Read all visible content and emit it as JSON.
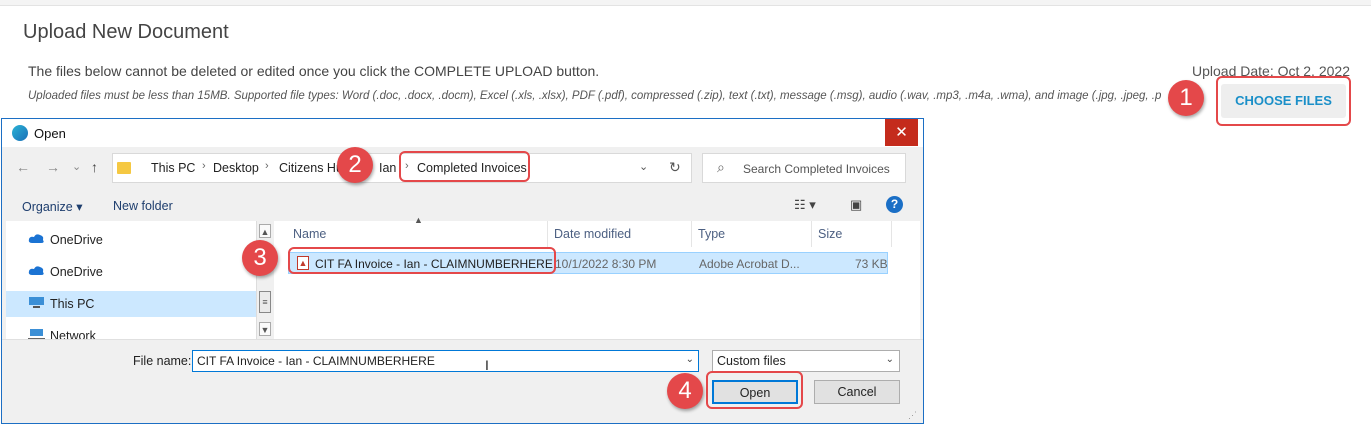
{
  "page": {
    "title": "Upload New Document",
    "note": "The files below cannot be deleted or edited once you click the COMPLETE UPLOAD button.",
    "file_types_note": "Uploaded files must be less than 15MB. Supported file types: Word (.doc, .docx, .docm), Excel (.xls, .xlsx), PDF (.pdf), compressed (.zip), text (.txt), message (.msg), audio (.wav, .mp3, .m4a, .wma), and image (.jpg, .jpeg, .p",
    "upload_date": "Upload Date: Oct 2, 2022",
    "choose_files_label": "CHOOSE FILES"
  },
  "steps": [
    "1",
    "2",
    "3",
    "4"
  ],
  "colors": {
    "annotation": "#e4484a",
    "accent": "#1a8fc8",
    "selection": "#cce8ff"
  },
  "dialog": {
    "title": "Open",
    "close_glyph": "✕",
    "nav": {
      "back": "←",
      "forward": "→",
      "recent": "⌄",
      "up": "↑"
    },
    "breadcrumb": [
      "This PC",
      "Desktop",
      "Citizens Hu",
      "Ian",
      "Completed Invoices"
    ],
    "breadcrumb_sep": "›",
    "search_placeholder": "Search Completed Invoices",
    "toolbar": {
      "organize": "Organize ▾",
      "new_folder": "New folder",
      "help": "?"
    },
    "nav_pane": [
      {
        "label": "OneDrive",
        "icon": "cloud-icon"
      },
      {
        "label": "OneDrive",
        "icon": "cloud-icon"
      },
      {
        "label": "This PC",
        "icon": "computer-icon"
      },
      {
        "label": "Network",
        "icon": "network-icon"
      }
    ],
    "columns": [
      "Name",
      "Date modified",
      "Type",
      "Size"
    ],
    "files": [
      {
        "name": "CIT FA Invoice - Ian - CLAIMNUMBERHERE",
        "date": "10/1/2022 8:30 PM",
        "type": "Adobe Acrobat D...",
        "size": "73 KB"
      }
    ],
    "file_name_label": "File name:",
    "file_name_value": "CIT FA Invoice - Ian - CLAIMNUMBERHERE",
    "file_type": "Custom files",
    "open_label": "Open",
    "cancel_label": "Cancel"
  }
}
